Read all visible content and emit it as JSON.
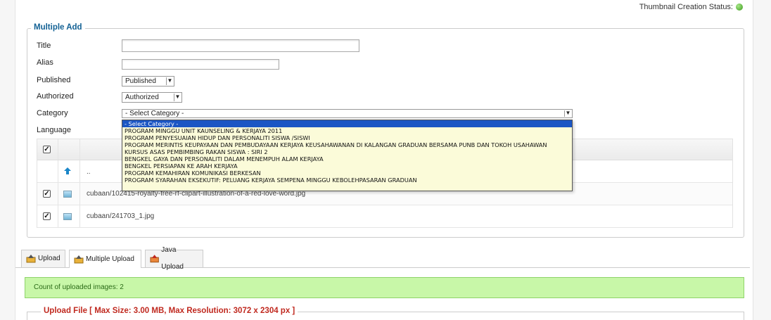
{
  "thumbnail_status": {
    "label": "Thumbnail Creation Status:"
  },
  "multiple_add": {
    "legend": "Multiple Add",
    "title_label": "Title",
    "title_value": "",
    "alias_label": "Alias",
    "alias_value": "",
    "published_label": "Published",
    "published_value": "Published",
    "authorized_label": "Authorized",
    "authorized_value": "Authorized",
    "category_label": "Category",
    "category_value": "- Select Category -",
    "language_label": "Language"
  },
  "category_options": [
    "- Select Category -",
    "PROGRAM MINGGU UNIT KAUNSELING & KERJAYA 2011",
    "PROGRAM PENYESUAIAN HIDUP DAN PERSONALITI SISWA /SISWI",
    "PROGRAM MERINTIS KEUPAYAAN DAN PEMBUDAYAAN KERJAYA KEUSAHAWANAN DI KALANGAN GRADUAN BERSAMA PUNB DAN TOKOH USAHAWAN",
    "KURSUS ASAS PEMBIMBING RAKAN SISWA : SIRI 2",
    "BENGKEL GAYA DAN PERSONALITI DALAM MENEMPUH ALAM KERJAYA",
    "BENGKEL PERSIAPAN KE ARAH KERJAYA",
    "PROGRAM KEMAHIRAN KOMUNIKASI BERKESAN",
    "PROGRAM SYARAHAN EKSEKUTIF: PELUANG KERJAYA SEMPENA MINGGU KEBOLEHPASARAN GRADUAN"
  ],
  "file_table": {
    "parent_label": "..",
    "files": [
      {
        "name": "cubaan/102415-royalty-free-rf-clipart-illustration-of-a-red-love-word.jpg",
        "checked": true
      },
      {
        "name": "cubaan/241703_1.jpg",
        "checked": true
      }
    ]
  },
  "tabs": [
    {
      "label": "Upload",
      "icon": "upload-icon"
    },
    {
      "label": "Multiple Upload",
      "icon": "multiple-upload-icon"
    },
    {
      "label": "Java Upload",
      "icon": "java-upload-icon"
    }
  ],
  "upload_panel": {
    "count_message": "Count of uploaded images: 2",
    "upload_legend": "Upload File [ Max Size: 3.00 MB, Max Resolution: 3072 x 2304 px ]"
  },
  "colors": {
    "legend_blue": "#146295",
    "upload_red": "#c0291f",
    "notice_green": "#c8f7a8",
    "selected_option": "#1b56c4",
    "dropdown_bg": "#fbfbd9"
  }
}
